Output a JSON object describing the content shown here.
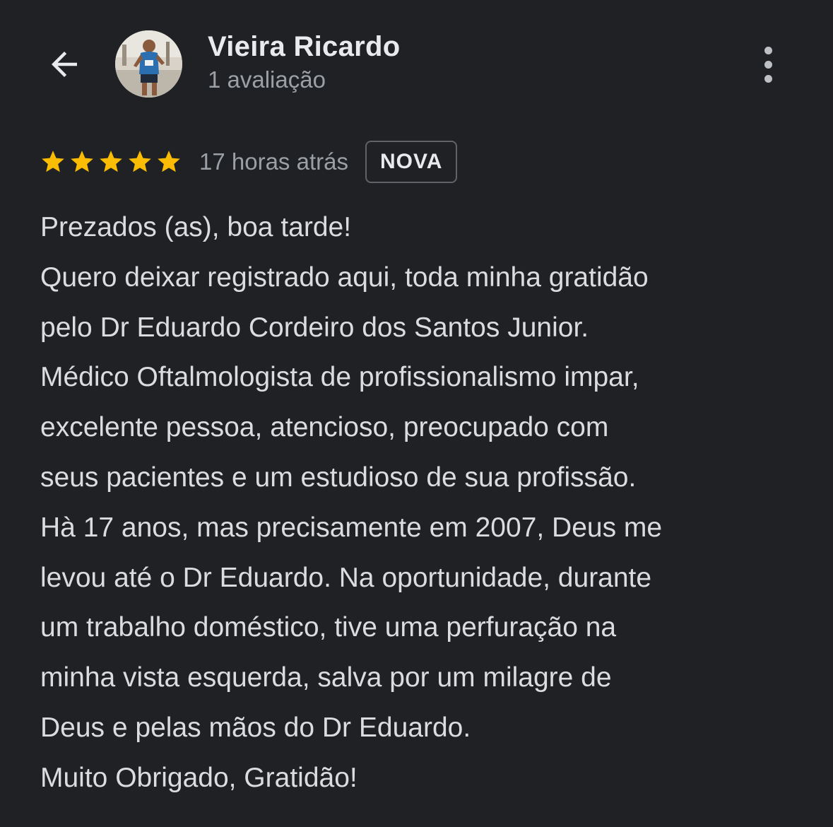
{
  "header": {
    "back_icon": "arrow-back-icon",
    "reviewer_name": "Vieira Ricardo",
    "review_count": "1 avaliação",
    "more_icon": "more-vertical-icon"
  },
  "review": {
    "rating": 5,
    "rating_max": 5,
    "star_color": "#fbbc04",
    "timestamp": "17 horas atrás",
    "badge": "NOVA",
    "lines": [
      "Prezados (as), boa tarde!",
      "Quero deixar registrado aqui, toda minha gratidão",
      "pelo Dr Eduardo Cordeiro dos Santos Junior.",
      "Médico Oftalmologista de profissionalismo impar,",
      "excelente pessoa, atencioso, preocupado com",
      "seus pacientes e um estudioso de sua profissão.",
      "Hà 17 anos, mas precisamente em 2007, Deus me",
      "levou até o Dr Eduardo. Na oportunidade, durante",
      "um trabalho doméstico, tive uma perfuração na",
      "minha vista esquerda, salva por um milagre de",
      "Deus e pelas mãos do Dr Eduardo.",
      "Muito Obrigado, Gratidão!"
    ]
  },
  "colors": {
    "background": "#202124",
    "primary_text": "#e8eaed",
    "secondary_text": "#9aa0a6",
    "star": "#fbbc04"
  }
}
